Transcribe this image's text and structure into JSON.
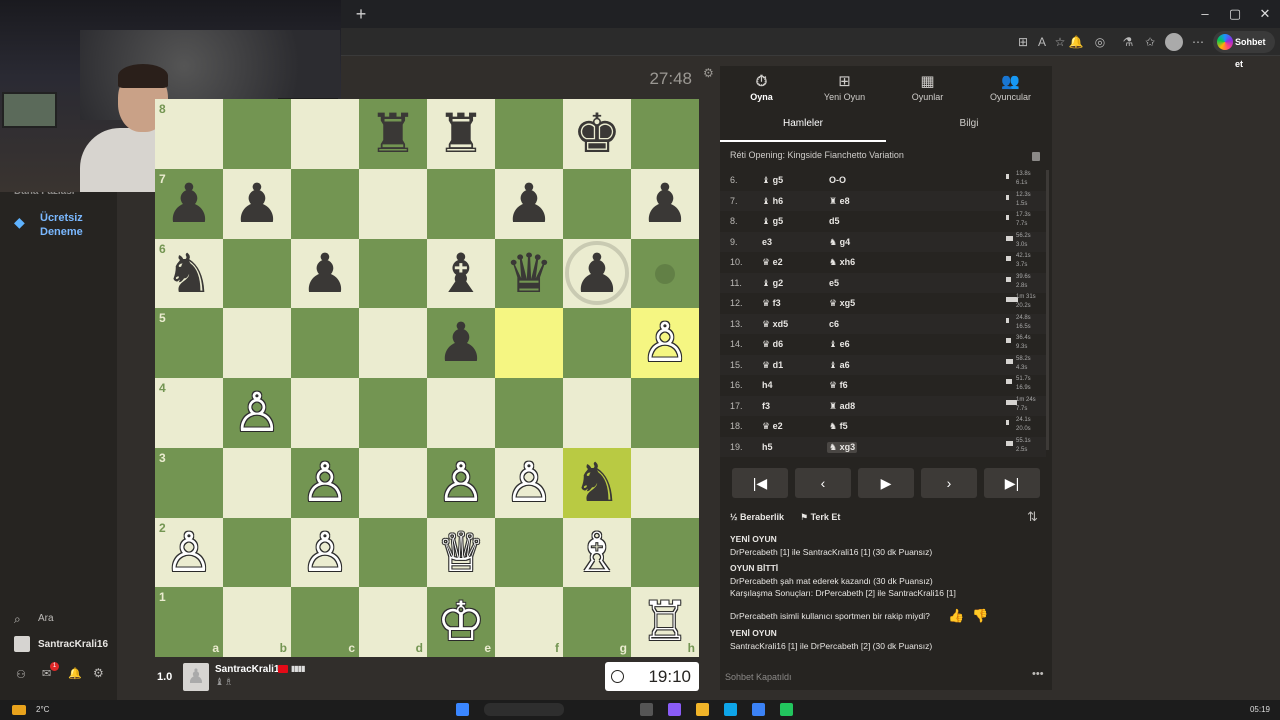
{
  "browser": {
    "new_tab_label": "+",
    "window_controls": [
      "–",
      "▢",
      "✕"
    ],
    "toolbar_icons": [
      "⊞",
      "A",
      "☆",
      "🔔",
      "◎",
      "⚗",
      "✩",
      "⋯"
    ],
    "copilot_label": "Sohbet et"
  },
  "sidebar": {
    "partial_item": "Daha Fazlası",
    "trial_label": "Ücretsiz Deneme",
    "search_label": "Ara",
    "username": "SantracKrali16",
    "notification_badge": "1"
  },
  "game": {
    "opponent_clock": "27:48",
    "player_clock": "19:10",
    "player_score": "1.0",
    "player_name": "SantracKrali16",
    "player_captured": "♝♗",
    "files": [
      "a",
      "b",
      "c",
      "d",
      "e",
      "f",
      "g",
      "h"
    ],
    "ranks": [
      "8",
      "7",
      "6",
      "5",
      "4",
      "3",
      "2",
      "1"
    ],
    "pieces": [
      [
        "",
        "",
        "",
        "♜",
        "♜",
        "",
        "♚",
        ""
      ],
      [
        "♟",
        "♟",
        "",
        "",
        "",
        "♟",
        "",
        "♟"
      ],
      [
        "♞",
        "",
        "♟",
        "",
        "♝",
        "♛",
        "♟",
        ""
      ],
      [
        "",
        "",
        "",
        "",
        "♟",
        "",
        "",
        "♙"
      ],
      [
        "",
        "♙",
        "",
        "",
        "",
        "",
        "",
        ""
      ],
      [
        "",
        "",
        "♙",
        "",
        "♙",
        "♙",
        "♞",
        ""
      ],
      [
        "♙",
        "",
        "♙",
        "",
        "♕",
        "",
        "♗",
        ""
      ],
      [
        "",
        "",
        "",
        "",
        "♔",
        "",
        "",
        "♖"
      ]
    ]
  },
  "panel": {
    "nav": [
      {
        "label": "Oyna",
        "icon": "⏱"
      },
      {
        "label": "Yeni Oyun",
        "icon": "⊞"
      },
      {
        "label": "Oyunlar",
        "icon": "▦"
      },
      {
        "label": "Oyuncular",
        "icon": "👥"
      }
    ],
    "tabs": [
      "Hamleler",
      "Bilgi"
    ],
    "opening": "Réti Opening: Kingside Fianchetto Variation",
    "moves": [
      {
        "no": "6.",
        "w": "♝ g5",
        "b": "O-O",
        "t1": "13.8s",
        "t2": "6.1s",
        "bar": 0.08
      },
      {
        "no": "7.",
        "w": "♝ h6",
        "b": "♜ e8",
        "t1": "12.3s",
        "t2": "1.5s",
        "bar": 0.07
      },
      {
        "no": "8.",
        "w": "♝ g5",
        "b": "d5",
        "t1": "17.3s",
        "t2": "7.7s",
        "bar": 0.09
      },
      {
        "no": "9.",
        "w": "e3",
        "b": "♞ g4",
        "t1": "56.2s",
        "t2": "3.0s",
        "bar": 0.3
      },
      {
        "no": "10.",
        "w": "♛ e2",
        "b": "♞ xh6",
        "t1": "42.1s",
        "t2": "3.7s",
        "bar": 0.22
      },
      {
        "no": "11.",
        "w": "♝ g2",
        "b": "e5",
        "t1": "39.6s",
        "t2": "2.8s",
        "bar": 0.2
      },
      {
        "no": "12.",
        "w": "♛ f3",
        "b": "♛ xg5",
        "t1": "1m 31s",
        "t2": "20.2s",
        "bar": 0.48
      },
      {
        "no": "13.",
        "w": "♛ xd5",
        "b": "c6",
        "t1": "24.8s",
        "t2": "16.5s",
        "bar": 0.13
      },
      {
        "no": "14.",
        "w": "♛ d6",
        "b": "♝ e6",
        "t1": "36.4s",
        "t2": "9.3s",
        "bar": 0.19
      },
      {
        "no": "15.",
        "w": "♛ d1",
        "b": "♝ a6",
        "t1": "58.2s",
        "t2": "4.3s",
        "bar": 0.3
      },
      {
        "no": "16.",
        "w": "h4",
        "b": "♛ f6",
        "t1": "51.7s",
        "t2": "16.9s",
        "bar": 0.27
      },
      {
        "no": "17.",
        "w": "f3",
        "b": "♜ ad8",
        "t1": "1m 24s",
        "t2": "7.7s",
        "bar": 0.45
      },
      {
        "no": "18.",
        "w": "♛ e2",
        "b": "♞ f5",
        "t1": "24.1s",
        "t2": "20.0s",
        "bar": 0.13
      },
      {
        "no": "19.",
        "w": "h5",
        "b": "♞ xg3",
        "t1": "55.1s",
        "t2": "2.5s",
        "bar": 0.29
      }
    ],
    "nav_buttons": [
      "|◀",
      "‹",
      "▶",
      "›",
      "▶|"
    ],
    "draw_label": "½ Beraberlik",
    "resign_label": "⚑ Terk Et",
    "flip_icon": "⇅",
    "chat": [
      {
        "text": "YENİ OYUN",
        "header": true
      },
      {
        "text": "DrPercabeth [1] ile SantracKrali16 [1] (30 dk Puansız)"
      },
      {
        "text": "OYUN BİTTİ",
        "header": true
      },
      {
        "text": "DrPercabeth şah mat ederek kazandı (30 dk Puansız)"
      },
      {
        "text": "Karşılaşma Sonuçları: DrPercabeth [2] ile SantracKrali16 [1]"
      },
      {
        "text": "DrPercabeth isimli kullanıcı sportmen bir rakip miydi?"
      },
      {
        "text": "YENİ OYUN",
        "header": true
      },
      {
        "text": "SantracKrali16 [1] ile DrPercabeth [2] (30 dk Puansız)"
      }
    ],
    "chat_closed": "Sohbet Kapatıldı"
  },
  "taskbar": {
    "temperature": "2°C",
    "time": "05:19"
  }
}
